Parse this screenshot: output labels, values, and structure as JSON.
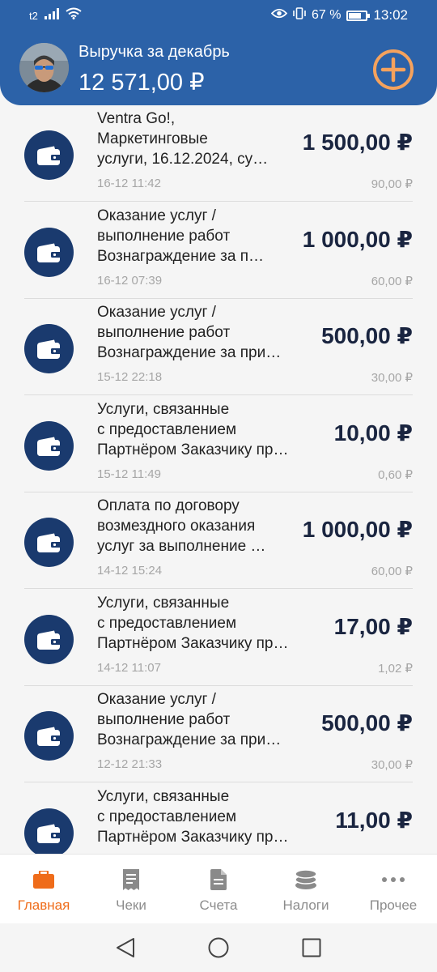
{
  "status_bar": {
    "carrier": "t2",
    "battery": "67 %",
    "time": "13:02"
  },
  "header": {
    "title": "Выручка за декабрь",
    "amount": "12 571,00 ₽"
  },
  "transactions": [
    {
      "title_lines": [
        "Ventra Go!,",
        "Маркетинговые",
        "услуги, 16.12.2024, су…"
      ],
      "amount": "1 500,00 ₽",
      "date": "16-12 11:42",
      "fee": "90,00 ₽"
    },
    {
      "title_lines": [
        "Оказание услуг /",
        "выполнение работ",
        "Вознаграждение за п…"
      ],
      "amount": "1 000,00 ₽",
      "date": "16-12 07:39",
      "fee": "60,00 ₽"
    },
    {
      "title_lines": [
        "Оказание услуг /",
        "выполнение работ",
        "Вознаграждение за при…"
      ],
      "amount": "500,00 ₽",
      "date": "15-12 22:18",
      "fee": "30,00 ₽"
    },
    {
      "title_lines": [
        "Услуги, связанные",
        "с предоставлением",
        "Партнёром Заказчику пра…"
      ],
      "amount": "10,00 ₽",
      "date": "15-12 11:49",
      "fee": "0,60 ₽"
    },
    {
      "title_lines": [
        "Оплата по договору",
        "возмездного оказания",
        "услуг за выполнение …"
      ],
      "amount": "1 000,00 ₽",
      "date": "14-12 15:24",
      "fee": "60,00 ₽"
    },
    {
      "title_lines": [
        "Услуги, связанные",
        "с предоставлением",
        "Партнёром Заказчику пра…"
      ],
      "amount": "17,00 ₽",
      "date": "14-12 11:07",
      "fee": "1,02 ₽"
    },
    {
      "title_lines": [
        "Оказание услуг /",
        "выполнение работ",
        "Вознаграждение за при…"
      ],
      "amount": "500,00 ₽",
      "date": "12-12 21:33",
      "fee": "30,00 ₽"
    },
    {
      "title_lines": [
        "Услуги, связанные",
        "с предоставлением",
        "Партнёром Заказчику пра…"
      ],
      "amount": "11,00 ₽",
      "date": "",
      "fee": ""
    }
  ],
  "bottom_nav": [
    {
      "label": "Главная",
      "icon": "briefcase-icon",
      "active": true
    },
    {
      "label": "Чеки",
      "icon": "receipt-icon",
      "active": false
    },
    {
      "label": "Счета",
      "icon": "document-icon",
      "active": false
    },
    {
      "label": "Налоги",
      "icon": "coins-icon",
      "active": false
    },
    {
      "label": "Прочее",
      "icon": "more-dots-icon",
      "active": false
    }
  ],
  "colors": {
    "header_bg": "#2c62a8",
    "accent": "#ef6c1a",
    "icon_circle": "#1a3a6e",
    "add_button": "#f5a25d"
  }
}
